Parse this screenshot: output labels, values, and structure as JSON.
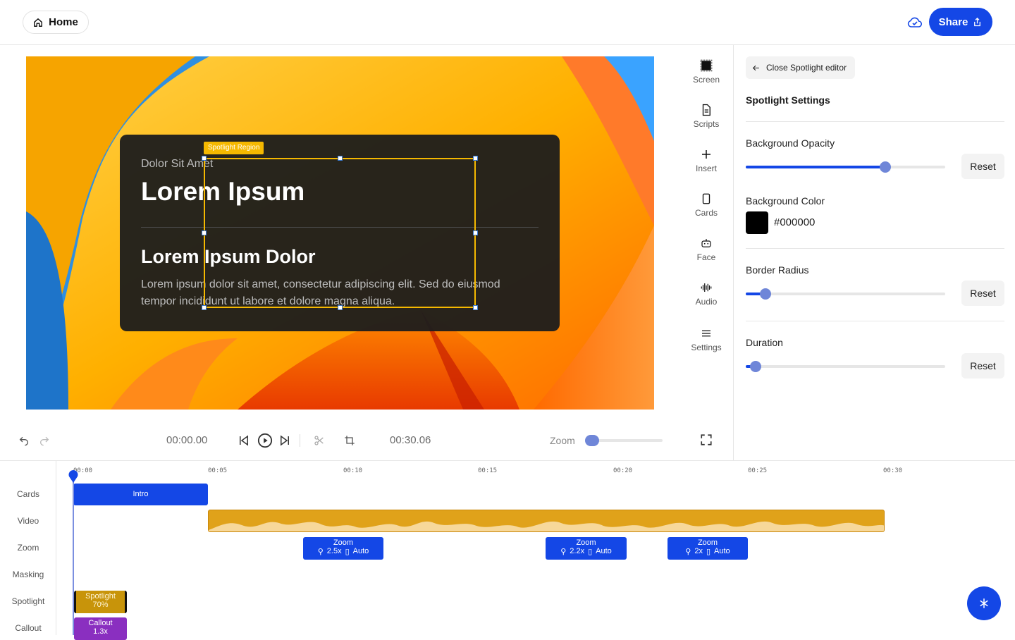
{
  "header": {
    "home_label": "Home",
    "share_label": "Share"
  },
  "canvas": {
    "card": {
      "subtitle": "Dolor Sit Amet",
      "title": "Lorem Ipsum",
      "heading": "Lorem Ipsum Dolor",
      "body": "Lorem ipsum dolor sit amet, consectetur adipiscing elit. Sed do eiusmod tempor incididunt ut labore et dolore magna aliqua."
    },
    "spotlight_label": "Spotlight Region"
  },
  "tools": [
    {
      "label": "Screen",
      "icon": "screen-icon"
    },
    {
      "label": "Scripts",
      "icon": "document-icon"
    },
    {
      "label": "Insert",
      "icon": "plus-icon"
    },
    {
      "label": "Cards",
      "icon": "card-icon"
    },
    {
      "label": "Face",
      "icon": "robot-icon"
    },
    {
      "label": "Audio",
      "icon": "waveform-icon"
    },
    {
      "label": "Settings",
      "icon": "menu-icon"
    }
  ],
  "panel": {
    "close_label": "Close Spotlight editor",
    "title": "Spotlight Settings",
    "opacity": {
      "label": "Background Opacity",
      "value": 0.7,
      "reset": "Reset"
    },
    "color": {
      "label": "Background Color",
      "hex": "#000000"
    },
    "radius": {
      "label": "Border Radius",
      "value": 0.1,
      "reset": "Reset"
    },
    "duration": {
      "label": "Duration",
      "value": 0.05,
      "reset": "Reset"
    }
  },
  "player": {
    "current_time": "00:00.00",
    "total_time": "00:30.06",
    "zoom_label": "Zoom",
    "zoom_value": 0.0
  },
  "timeline": {
    "tracks": [
      "Cards",
      "Video",
      "Zoom",
      "Masking",
      "Spotlight",
      "Callout"
    ],
    "ticks": [
      "00:00",
      "00:05",
      "00:10",
      "00:15",
      "00:20",
      "00:25",
      "00:30"
    ],
    "intro_clip": "Intro",
    "zoom_clips": [
      {
        "title": "Zoom",
        "scale": "2.5x",
        "mode": "Auto"
      },
      {
        "title": "Zoom",
        "scale": "2.2x",
        "mode": "Auto"
      },
      {
        "title": "Zoom",
        "scale": "2x",
        "mode": "Auto"
      }
    ],
    "spotlight_clip": {
      "title": "Spotlight",
      "value": "70%"
    },
    "callout_clip": {
      "title": "Callout",
      "value": "1.3x"
    }
  },
  "colors": {
    "accent": "#1447e6",
    "spotlight": "#f5b800",
    "video_clip": "#e0a21a",
    "callout": "#8a2fc0",
    "panel_bg": "#f3f3f3"
  }
}
